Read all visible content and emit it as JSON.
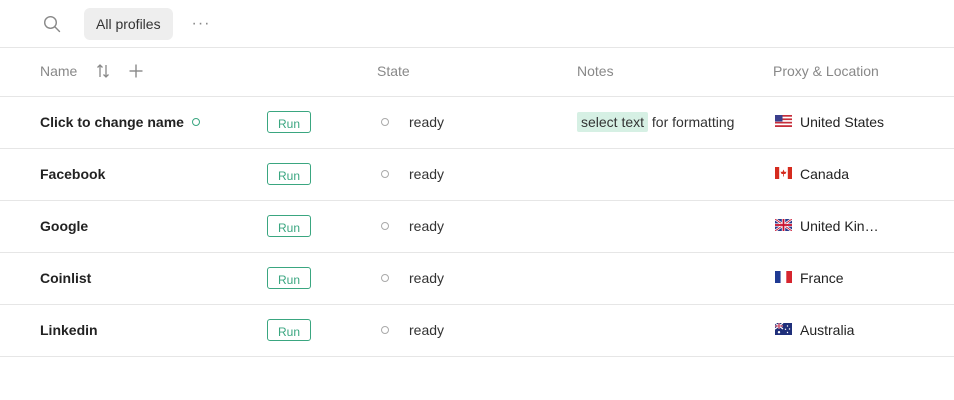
{
  "toolbar": {
    "search_icon": "search-icon",
    "tab_label": "All profiles",
    "more_label": "···"
  },
  "columns": {
    "name": "Name",
    "state": "State",
    "notes": "Notes",
    "proxy": "Proxy & Location"
  },
  "colors": {
    "accent": "#3aa680",
    "highlight": "#d6f0e4",
    "border": "#e6e6e6"
  },
  "rows": [
    {
      "name": "Click to change name",
      "run_label": "Run",
      "state": "ready",
      "notes_highlight": "select text",
      "notes_rest": " for formatting",
      "flag": "us-flag-icon",
      "location": "United States"
    },
    {
      "name": "Facebook",
      "run_label": "Run",
      "state": "ready",
      "flag": "ca-flag-icon",
      "location": "Canada"
    },
    {
      "name": "Google",
      "run_label": "Run",
      "state": "ready",
      "flag": "gb-flag-icon",
      "location": "United Kingdom"
    },
    {
      "name": "Coinlist",
      "run_label": "Run",
      "state": "ready",
      "flag": "fr-flag-icon",
      "location": "France"
    },
    {
      "name": "Linkedin",
      "run_label": "Run",
      "state": "ready",
      "flag": "au-flag-icon",
      "location": "Australia"
    }
  ]
}
